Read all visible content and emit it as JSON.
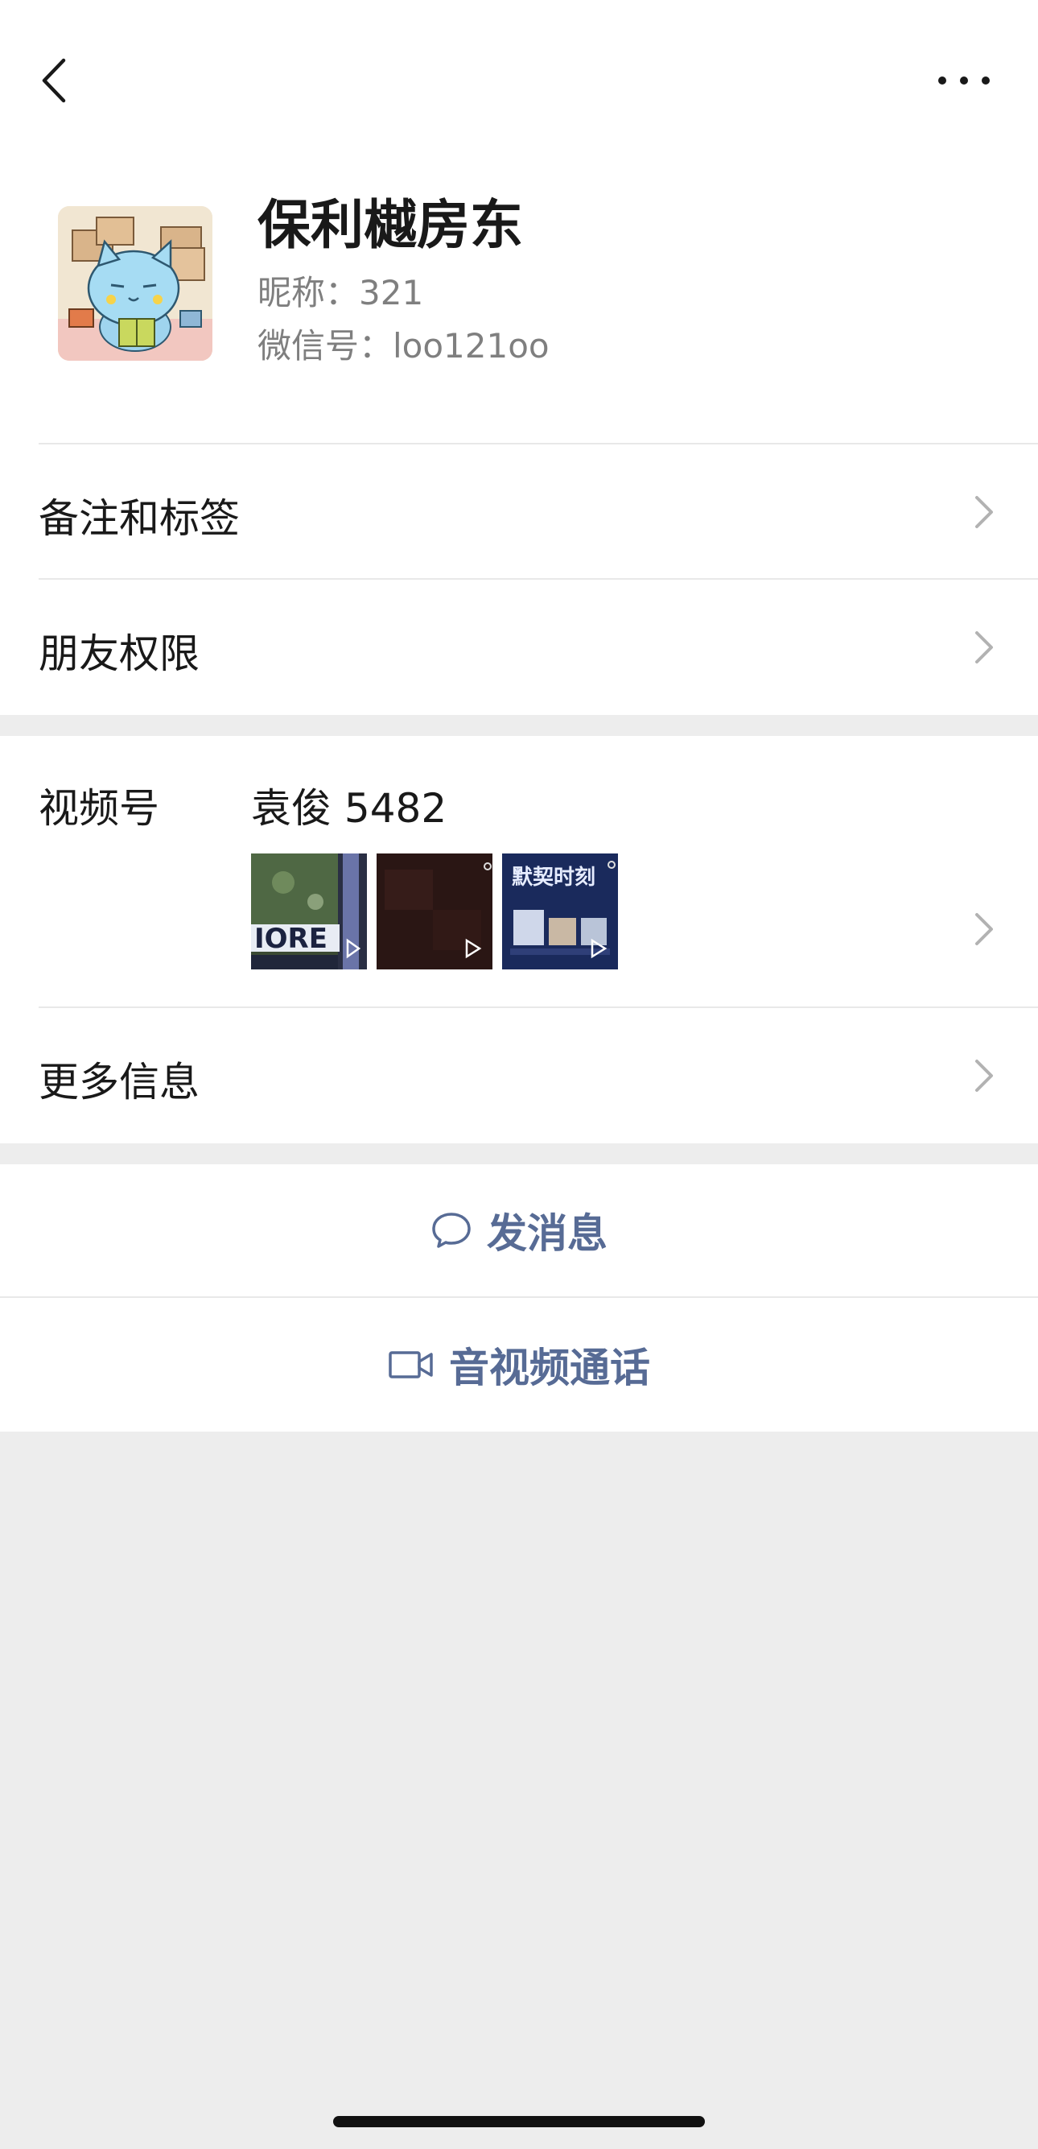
{
  "profile": {
    "display_name": "保利樾房东",
    "nickname": "昵称：321",
    "wechat_id": "微信号：loo121oo"
  },
  "menu": {
    "remarks_tags": "备注和标签",
    "friend_permissions": "朋友权限",
    "channels_label": "视频号",
    "channels_name": "袁俊 5482",
    "more_info": "更多信息"
  },
  "channel_thumbnails": [
    {
      "text": "IORE",
      "theme": "game-map"
    },
    {
      "text": "",
      "theme": "dark"
    },
    {
      "text": "默契时刻",
      "theme": "blue-poster"
    }
  ],
  "actions": {
    "send_message": "发消息",
    "av_call": "音视频通话"
  },
  "colors": {
    "link_blue": "#576b95",
    "background": "#ededed",
    "chevron": "#b2b2b2"
  }
}
